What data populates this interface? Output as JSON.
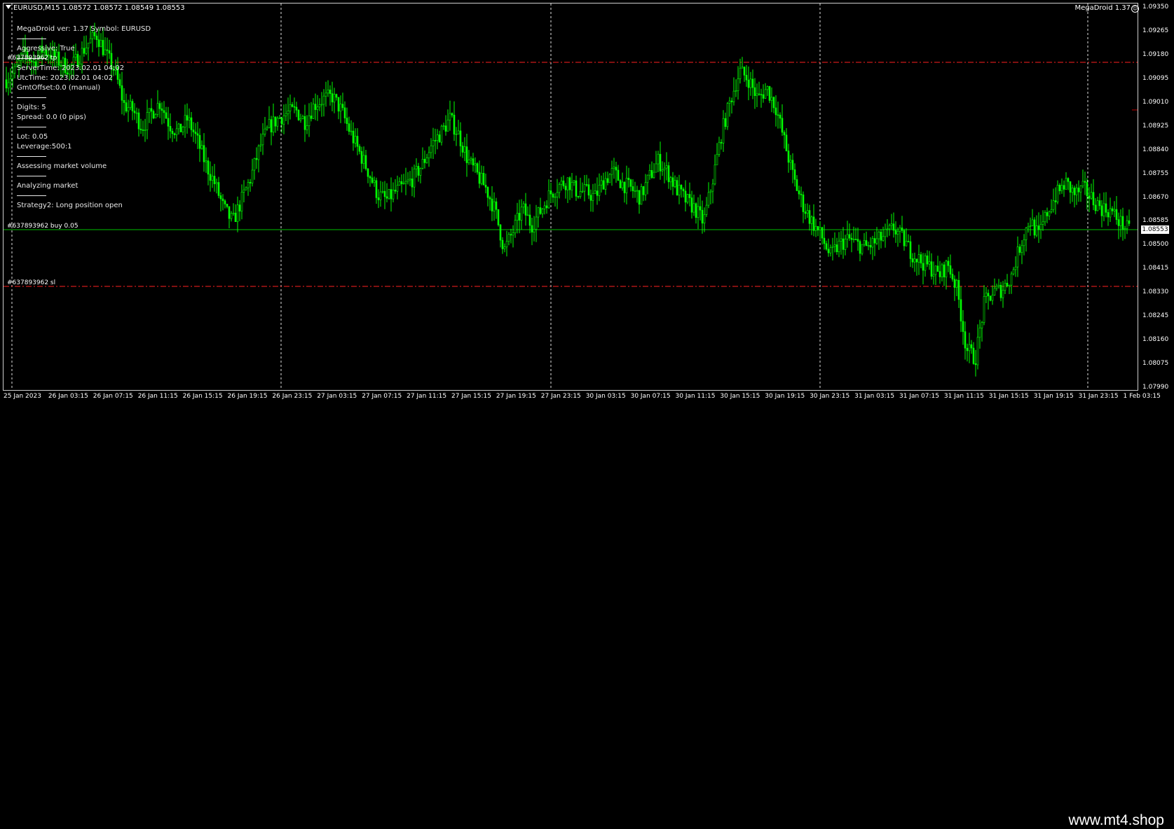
{
  "chart": {
    "symbol_header": "EURUSD,M15  1.08572 1.08572 1.08549 1.08553",
    "ea_badge": "MegaDroid 1.37",
    "bid_price": "1.08553",
    "colors": {
      "background": "#000000",
      "candles": "#00ff00",
      "stop_lines": "#ff0000",
      "order_line": "#00c000",
      "grid": "#ffffff"
    }
  },
  "ea_info": {
    "line1": "MegaDroid ver: 1.37 Symbol: EURUSD",
    "aggressive": "Aggressive: True",
    "server_time": "ServerTime: 2023.02.01 04:02",
    "utc_time": "UtcTime: 2023.02.01 04:02",
    "gmt_offset": "GmtOffset:0.0 (manual)",
    "digits": "Digits:  5",
    "spread": "Spread: 0.0 (0 pips)",
    "lot": "Lot:  0.05",
    "leverage": "Leverage:500:1",
    "status1": "Assessing market volume",
    "status2": "Analyzing market",
    "status3": "Strategy2: Long position open"
  },
  "orders": {
    "tp_label": "#637893962 tp",
    "buy_label": "#637893962 buy 0.05",
    "sl_label": "#637893962 sl"
  },
  "price_axis": [
    "1.09350",
    "1.09265",
    "1.09180",
    "1.09095",
    "1.09010",
    "1.08925",
    "1.08840",
    "1.08755",
    "1.08670",
    "1.08585",
    "1.08500",
    "1.08415",
    "1.08330",
    "1.08245",
    "1.08160",
    "1.08075",
    "1.07990"
  ],
  "time_axis": [
    "25 Jan 2023",
    "26 Jan 03:15",
    "26 Jan 07:15",
    "26 Jan 11:15",
    "26 Jan 15:15",
    "26 Jan 19:15",
    "26 Jan 23:15",
    "27 Jan 03:15",
    "27 Jan 07:15",
    "27 Jan 11:15",
    "27 Jan 15:15",
    "27 Jan 19:15",
    "27 Jan 23:15",
    "30 Jan 03:15",
    "30 Jan 07:15",
    "30 Jan 11:15",
    "30 Jan 15:15",
    "30 Jan 19:15",
    "30 Jan 23:15",
    "31 Jan 03:15",
    "31 Jan 07:15",
    "31 Jan 11:15",
    "31 Jan 15:15",
    "31 Jan 19:15",
    "31 Jan 23:15",
    "1 Feb 03:15"
  ],
  "watermark": "www.mt4.shop",
  "chart_data": {
    "type": "line",
    "series": [
      {
        "values": [
          1.0909,
          1.0912,
          1.0919,
          1.0915,
          1.092,
          1.0918,
          1.0915,
          1.0913,
          1.0917,
          1.0922,
          1.0925,
          1.0918,
          1.0912,
          1.09,
          1.0898,
          1.0892,
          1.0897,
          1.0901,
          1.0893,
          1.089,
          1.0895,
          1.0888,
          1.0879,
          1.0872,
          1.0863,
          1.0858,
          1.0866,
          1.0874,
          1.0885,
          1.0892,
          1.0895,
          1.0897,
          1.0898,
          1.0894,
          1.09,
          1.0902,
          1.0903,
          1.0898,
          1.089,
          1.0883,
          1.0876,
          1.0868,
          1.0866,
          1.0869,
          1.0871,
          1.0874,
          1.0879,
          1.0886,
          1.089,
          1.0895,
          1.0889,
          1.088,
          1.0875,
          1.087,
          1.0862,
          1.0848,
          1.0855,
          1.0863,
          1.0857,
          1.0862,
          1.0868,
          1.0871,
          1.0873,
          1.0869,
          1.0869,
          1.0867,
          1.0873,
          1.0876,
          1.0872,
          1.087,
          1.0867,
          1.0874,
          1.088,
          1.0876,
          1.087,
          1.0866,
          1.0863,
          1.0858,
          1.0873,
          1.089,
          1.0902,
          1.0912,
          1.0909,
          1.0902,
          1.0906,
          1.0899,
          1.0886,
          1.0873,
          1.0864,
          1.0858,
          1.0853,
          1.0846,
          1.085,
          1.0852,
          1.085,
          1.0849,
          1.0851,
          1.0853,
          1.0856,
          1.0852,
          1.0847,
          1.0844,
          1.0842,
          1.0839,
          1.0843,
          1.0834,
          1.0813,
          1.0809,
          1.0829,
          1.0833,
          1.0834,
          1.0839,
          1.085,
          1.0859,
          1.0853,
          1.0862,
          1.0868,
          1.0872,
          1.0868,
          1.087,
          1.0866,
          1.0863,
          1.0862,
          1.0858,
          1.0855
        ]
      }
    ]
  }
}
